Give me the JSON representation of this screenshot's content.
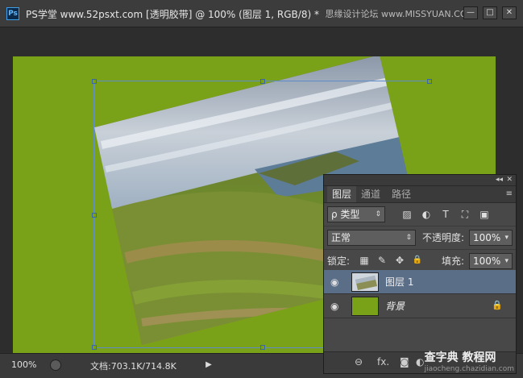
{
  "window": {
    "title": "PS学堂 www.52psxt.com [透明胶带] @ 100% (图层 1, RGB/8) *",
    "watermark": "思缘设计论坛 www.MISSYUAN.COM",
    "app_icon": "Ps",
    "buttons": {
      "minimize": "—",
      "maximize": "□",
      "close": "✕"
    }
  },
  "status": {
    "zoom": "100%",
    "doc_info": "文档:703.1K/714.8K",
    "arrow": "▶"
  },
  "colors": {
    "canvas": "#7aa218",
    "panel": "#484848",
    "selected_layer": "#5b6e88"
  },
  "layers_panel": {
    "collapse_icon": "◂◂",
    "close_icon": "✕",
    "tabs": [
      {
        "label": "图层"
      },
      {
        "label": "通道"
      },
      {
        "label": "路径"
      }
    ],
    "menu_icon": "≡",
    "filter": {
      "label": "ρ 类型",
      "arrow": "⇕"
    },
    "filter_icons": [
      "▨",
      "◐",
      "T",
      "⛶",
      "▣"
    ],
    "blend_mode": "正常",
    "opacity_label": "不透明度:",
    "opacity_value": "100%",
    "lock_label": "锁定:",
    "lock_icons": [
      "▦",
      "✎",
      "✥",
      "🔒"
    ],
    "fill_label": "填充:",
    "fill_value": "100%",
    "layers": [
      {
        "name": "图层 1",
        "selected": true
      },
      {
        "name": "背景",
        "selected": false,
        "locked": true
      }
    ],
    "bottom_icons": [
      "⊖",
      "fx.",
      "◙",
      "◐"
    ]
  },
  "bottom_watermark": {
    "main": "查字典 教程网",
    "url": "jiaocheng.chazidian.com"
  }
}
